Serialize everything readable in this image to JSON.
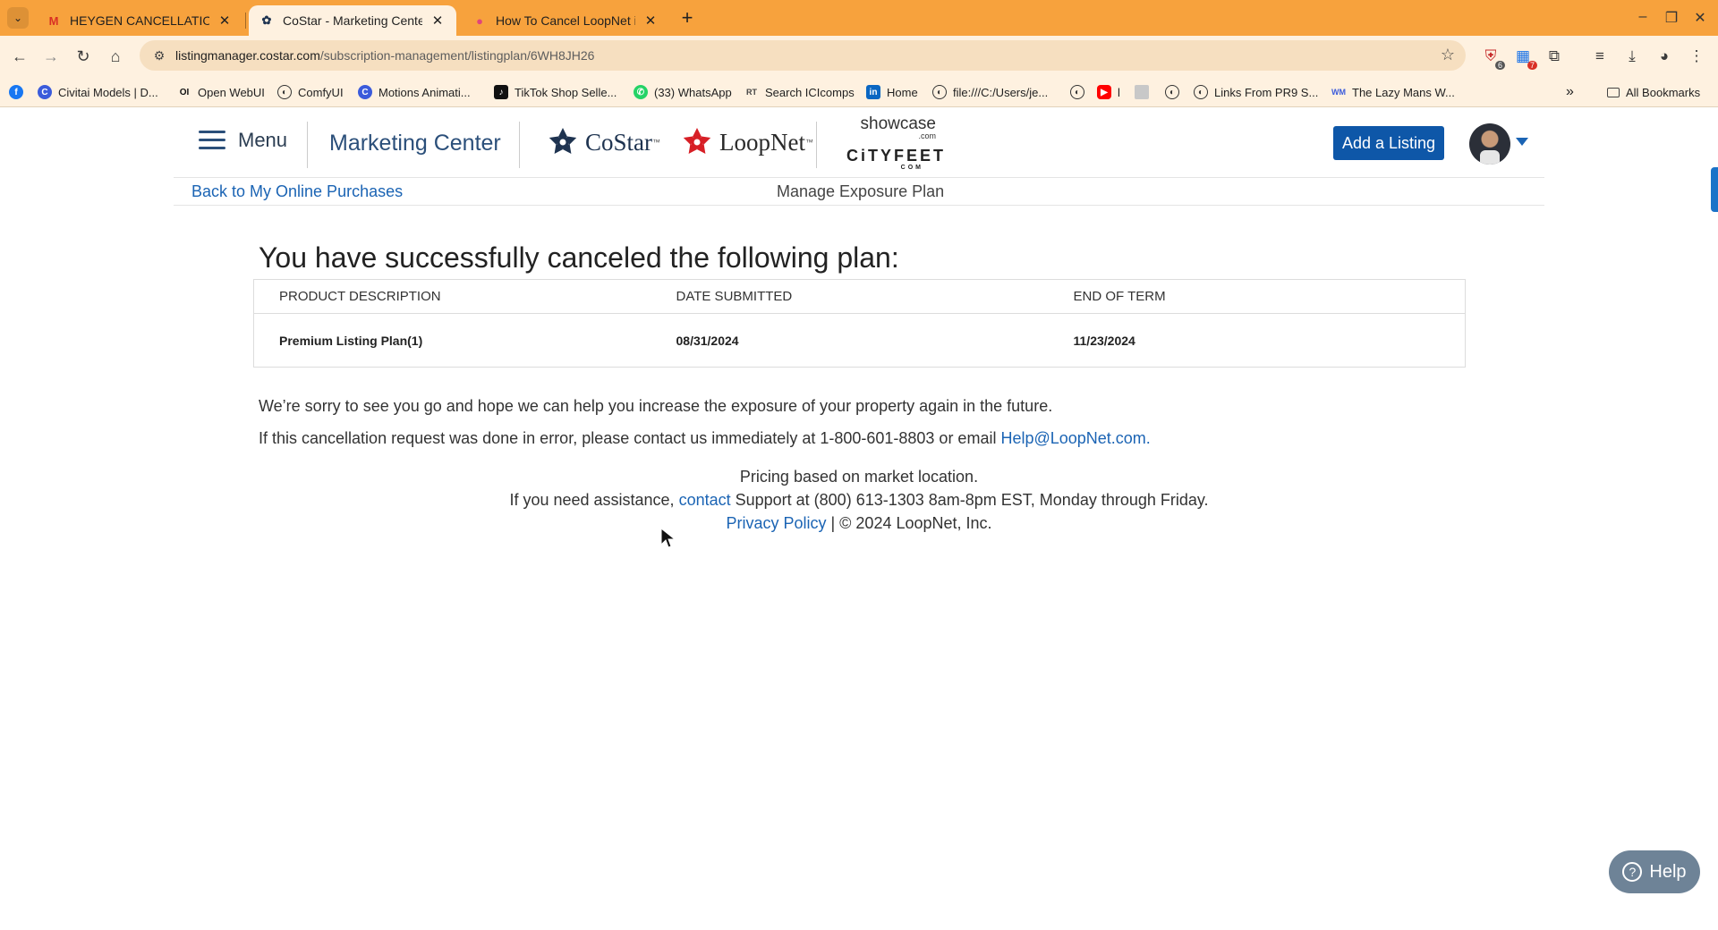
{
  "browser": {
    "tabs": [
      {
        "title": "HEYGEN CANCELLATION - Ja",
        "favicon": "gmail-icon",
        "active": false
      },
      {
        "title": "CoStar - Marketing Center",
        "favicon": "costar-icon",
        "active": true
      },
      {
        "title": "How To Cancel LoopNet in T",
        "favicon": "loopnet-icon",
        "active": false
      }
    ],
    "url_host": "listingmanager.costar.com",
    "url_path": "/subscription-management/listingplan/6WH8JH26",
    "extension_badges": [
      "6",
      "7"
    ],
    "bookmarks": [
      {
        "label": "",
        "icon": "facebook-icon",
        "color": "#1877f2"
      },
      {
        "label": "Civitai Models | D...",
        "icon": "civitai-icon",
        "color": "#3b5bdb"
      },
      {
        "label": "Open WebUI",
        "icon": "openwebui-icon",
        "color": "#111111"
      },
      {
        "label": "ComfyUI",
        "icon": "globe-icon",
        "color": "#333333"
      },
      {
        "label": "Motions Animati...",
        "icon": "motions-icon",
        "color": "#3b5bdb"
      },
      {
        "label": "TikTok Shop Selle...",
        "icon": "tiktok-icon",
        "color": "#111111"
      },
      {
        "label": "(33) WhatsApp",
        "icon": "whatsapp-icon",
        "color": "#25d366"
      },
      {
        "label": "Search ICIcomps",
        "icon": "rt-icon",
        "color": "#444444"
      },
      {
        "label": "Home",
        "icon": "linkedin-icon",
        "color": "#0a66c2"
      },
      {
        "label": "file:///C:/Users/je...",
        "icon": "globe-icon",
        "color": "#333333"
      },
      {
        "label": "",
        "icon": "globe-icon",
        "color": "#333333"
      },
      {
        "label": "l",
        "icon": "youtube-icon",
        "color": "#ff0000"
      },
      {
        "label": "",
        "icon": "image-icon",
        "color": "#bbbbbb"
      },
      {
        "label": "",
        "icon": "globe-icon",
        "color": "#333333"
      },
      {
        "label": "Links From PR9 S...",
        "icon": "globe-icon",
        "color": "#333333"
      },
      {
        "label": "The Lazy Mans W...",
        "icon": "wm-icon",
        "color": "#3b5bdb"
      }
    ],
    "all_bookmarks_label": "All Bookmarks"
  },
  "header": {
    "menu_label": "Menu",
    "title": "Marketing Center",
    "brands": {
      "costar": "CoStar",
      "loopnet": "LoopNet",
      "showcase": "showcase",
      "showcase_suffix": ".com",
      "cityfeet": "CiTYFEET",
      "cityfeet_suffix": "COM"
    },
    "add_listing_label": "Add a Listing"
  },
  "subnav": {
    "back_label": "Back to My Online Purchases",
    "title": "Manage Exposure Plan"
  },
  "main": {
    "headline": "You have successfully canceled the following plan:",
    "table": {
      "columns": [
        "PRODUCT DESCRIPTION",
        "DATE SUBMITTED",
        "END OF TERM"
      ],
      "rows": [
        [
          "Premium Listing Plan(1)",
          "08/31/2024",
          "11/23/2024"
        ]
      ]
    },
    "sorry_message": "We’re sorry to see you go and hope we can help you increase the exposure of your property again in the future.",
    "error_prefix": "If this cancellation request was done in error, please contact us immediately at 1-800-601-8803 or email ",
    "error_email": "Help@LoopNet.com."
  },
  "footer": {
    "pricing_note": "Pricing based on market location.",
    "assist_prefix": "If you need assistance, ",
    "assist_link": "contact",
    "assist_suffix": " Support at (800) 613-1303 8am-8pm EST, Monday through Friday.",
    "privacy_label": "Privacy Policy",
    "copyright": " | © 2024 LoopNet, Inc."
  },
  "help_button_label": "Help"
}
